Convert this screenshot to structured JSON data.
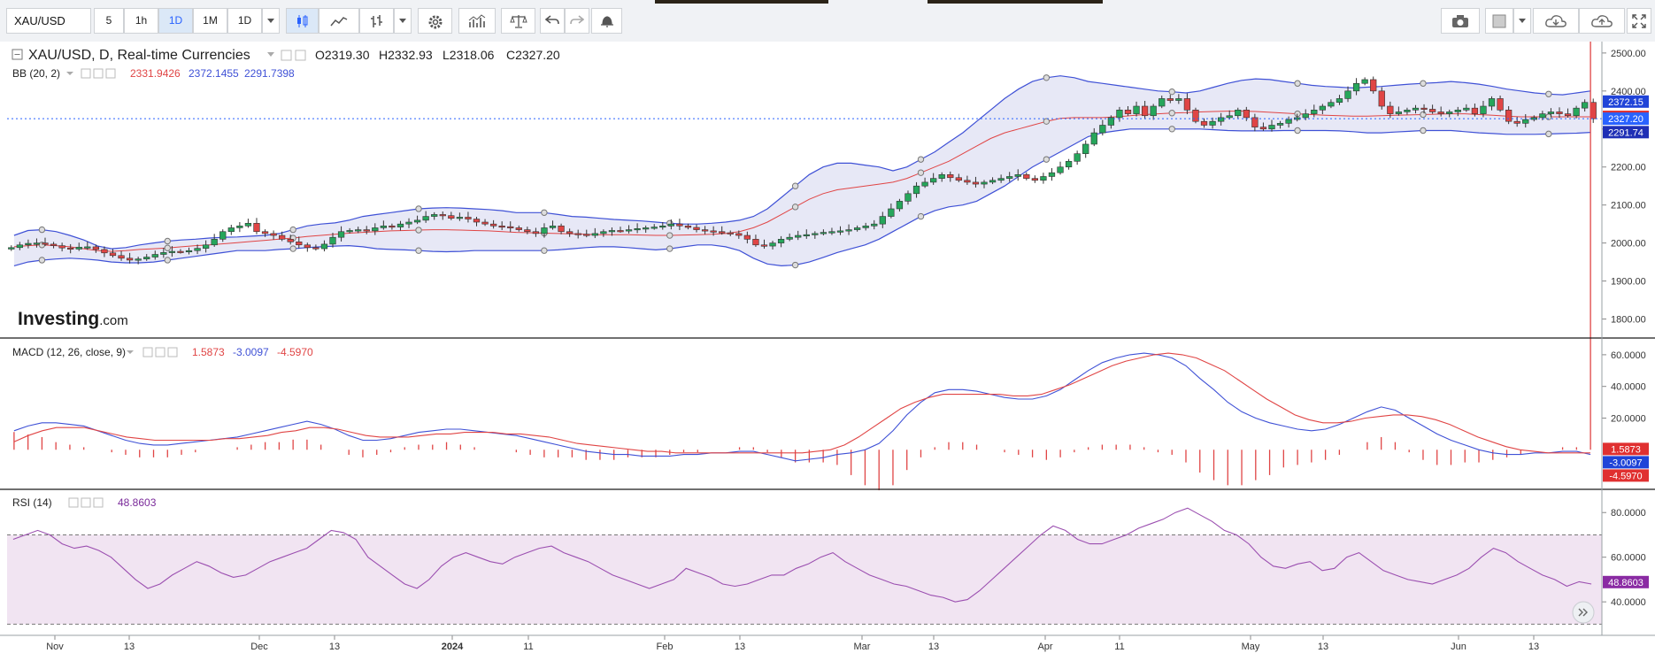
{
  "toolbar": {
    "symbol": "XAU/USD",
    "intervals": [
      "5",
      "1h",
      "1D",
      "1M",
      "1D"
    ],
    "active_interval_index": 2
  },
  "legend": {
    "title": "XAU/USD, D, Real-time Currencies",
    "open": "O2319.30",
    "high": "H2332.93",
    "low": "L2318.06",
    "close": "C2327.20",
    "bb_label": "BB (20, 2)",
    "bb_values": [
      "2331.9426",
      "2372.1455",
      "2291.7398"
    ],
    "macd_label": "MACD (12, 26, close, 9)",
    "macd_values": [
      "1.5873",
      "-3.0097",
      "-4.5970"
    ],
    "rsi_label": "RSI (14)",
    "rsi_value": "48.8603"
  },
  "watermark": {
    "brand": "Investing",
    "suffix": ".com"
  },
  "colors": {
    "up": "#26a65b",
    "down": "#e04545",
    "bb_band": "#3f51d6",
    "bb_mid": "#e04545",
    "bb_fill": "#e3e4f4",
    "macd_line": "#3f51d6",
    "signal_line": "#e04545",
    "rsi_line": "#9b4fb0",
    "rsi_fill": "#f1e4f2"
  },
  "chart_data": [
    {
      "type": "candlestick",
      "title": "XAU/USD, D, Real-time Currencies",
      "ylim": [
        1750,
        2530
      ],
      "y_ticks": [
        "2500.00",
        "2400.00",
        "2300.00",
        "2200.00",
        "2100.00",
        "2000.00",
        "1900.00",
        "1800.00"
      ],
      "x_ticks": [
        "Nov",
        "13",
        "Dec",
        "13",
        "2024",
        "11",
        "Feb",
        "13",
        "Mar",
        "13",
        "Apr",
        "11",
        "May",
        "13",
        "Jun",
        "13"
      ],
      "close_series": [
        1988,
        1995,
        1999,
        2000,
        1997,
        1993,
        1987,
        1984,
        1989,
        1990,
        1983,
        1974,
        1967,
        1960,
        1955,
        1958,
        1963,
        1970,
        1975,
        1978,
        1977,
        1980,
        1986,
        1995,
        2010,
        2030,
        2040,
        2045,
        2052,
        2030,
        2025,
        2020,
        2010,
        2003,
        1995,
        1988,
        1985,
        1997,
        2015,
        2030,
        2033,
        2035,
        2032,
        2040,
        2045,
        2042,
        2050,
        2055,
        2060,
        2070,
        2075,
        2072,
        2065,
        2068,
        2063,
        2055,
        2050,
        2045,
        2043,
        2040,
        2035,
        2030,
        2025,
        2040,
        2045,
        2030,
        2025,
        2023,
        2020,
        2025,
        2030,
        2033,
        2032,
        2035,
        2038,
        2040,
        2042,
        2045,
        2050,
        2045,
        2041,
        2035,
        2032,
        2030,
        2027,
        2025,
        2020,
        2010,
        1995,
        1992,
        2000,
        2010,
        2015,
        2020,
        2022,
        2025,
        2028,
        2030,
        2032,
        2035,
        2040,
        2045,
        2050,
        2070,
        2090,
        2110,
        2130,
        2150,
        2160,
        2170,
        2180,
        2172,
        2165,
        2160,
        2155,
        2160,
        2165,
        2170,
        2175,
        2180,
        2170,
        2165,
        2175,
        2185,
        2200,
        2215,
        2235,
        2260,
        2290,
        2310,
        2330,
        2350,
        2340,
        2360,
        2335,
        2360,
        2380,
        2375,
        2380,
        2350,
        2320,
        2310,
        2320,
        2330,
        2335,
        2350,
        2330,
        2305,
        2300,
        2310,
        2315,
        2325,
        2330,
        2340,
        2350,
        2360,
        2370,
        2380,
        2400,
        2420,
        2430,
        2400,
        2360,
        2340,
        2345,
        2350,
        2355,
        2352,
        2345,
        2340,
        2345,
        2350,
        2355,
        2340,
        2360,
        2380,
        2350,
        2320,
        2315,
        2325,
        2330,
        2340,
        2345,
        2340,
        2335,
        2355,
        2370,
        2327
      ],
      "bb_upper_series": [
        2020,
        2033,
        2035,
        2030,
        2020,
        2008,
        1992,
        1985,
        1988,
        1995,
        2000,
        2005,
        2008,
        2010,
        2013,
        2015,
        2016,
        2018,
        2020,
        2025,
        2035,
        2045,
        2050,
        2053,
        2060,
        2070,
        2075,
        2080,
        2085,
        2090,
        2092,
        2093,
        2092,
        2090,
        2088,
        2085,
        2080,
        2080,
        2080,
        2075,
        2070,
        2068,
        2065,
        2062,
        2060,
        2058,
        2055,
        2052,
        2050,
        2050,
        2052,
        2055,
        2060,
        2070,
        2090,
        2120,
        2150,
        2180,
        2200,
        2210,
        2210,
        2205,
        2200,
        2190,
        2200,
        2220,
        2240,
        2265,
        2290,
        2320,
        2350,
        2380,
        2405,
        2425,
        2435,
        2440,
        2435,
        2425,
        2420,
        2415,
        2410,
        2405,
        2400,
        2398,
        2395,
        2400,
        2410,
        2420,
        2428,
        2432,
        2430,
        2425,
        2420,
        2415,
        2412,
        2410,
        2408,
        2410,
        2412,
        2415,
        2418,
        2420,
        2422,
        2425,
        2422,
        2418,
        2412,
        2405,
        2400,
        2395,
        2392,
        2390,
        2395,
        2400
      ],
      "bb_mid_series": [
        1990,
        1993,
        1995,
        1993,
        1990,
        1985,
        1980,
        1978,
        1980,
        1983,
        1985,
        1987,
        1990,
        1993,
        1995,
        1998,
        2001,
        2004,
        2007,
        2010,
        2013,
        2017,
        2020,
        2023,
        2026,
        2028,
        2030,
        2032,
        2033,
        2034,
        2035,
        2035,
        2034,
        2033,
        2032,
        2030,
        2028,
        2027,
        2026,
        2025,
        2024,
        2023,
        2022,
        2022,
        2022,
        2021,
        2020,
        2020,
        2021,
        2022,
        2023,
        2025,
        2030,
        2040,
        2055,
        2075,
        2095,
        2115,
        2130,
        2140,
        2145,
        2150,
        2155,
        2160,
        2170,
        2185,
        2200,
        2215,
        2235,
        2255,
        2275,
        2290,
        2300,
        2310,
        2320,
        2328,
        2330,
        2330,
        2330,
        2332,
        2335,
        2338,
        2340,
        2342,
        2343,
        2345,
        2346,
        2347,
        2347,
        2346,
        2344,
        2342,
        2340,
        2338,
        2336,
        2335,
        2334,
        2334,
        2335,
        2336,
        2337,
        2338,
        2339,
        2340,
        2340,
        2338,
        2336,
        2334,
        2332,
        2332,
        2332,
        2332,
        2332,
        2332
      ],
      "bb_lower_series": [
        1940,
        1950,
        1955,
        1958,
        1960,
        1958,
        1955,
        1950,
        1948,
        1948,
        1950,
        1955,
        1960,
        1965,
        1970,
        1975,
        1980,
        1980,
        1980,
        1983,
        1985,
        1988,
        1990,
        1992,
        1993,
        1990,
        1985,
        1983,
        1982,
        1980,
        1978,
        1977,
        1978,
        1980,
        1980,
        1980,
        1980,
        1980,
        1980,
        1982,
        1985,
        1988,
        1990,
        1990,
        1988,
        1985,
        1982,
        1985,
        1990,
        1995,
        1995,
        1990,
        1980,
        1960,
        1945,
        1940,
        1942,
        1950,
        1962,
        1975,
        1985,
        1995,
        2010,
        2030,
        2050,
        2070,
        2085,
        2095,
        2100,
        2110,
        2130,
        2150,
        2175,
        2200,
        2220,
        2240,
        2260,
        2280,
        2290,
        2295,
        2300,
        2300,
        2300,
        2300,
        2300,
        2300,
        2298,
        2296,
        2295,
        2295,
        2295,
        2296,
        2296,
        2296,
        2296,
        2295,
        2293,
        2290,
        2290,
        2292,
        2294,
        2296,
        2296,
        2296,
        2293,
        2290,
        2288,
        2286,
        2286,
        2286,
        2287,
        2288,
        2289,
        2291
      ]
    },
    {
      "type": "line",
      "title": "MACD (12, 26, close, 9)",
      "ylim": [
        -25,
        70
      ],
      "y_ticks": [
        "60.0000",
        "40.0000",
        "20.0000"
      ],
      "series": [
        {
          "name": "MACD",
          "values": [
            12,
            15,
            17,
            17,
            16,
            15,
            12,
            9,
            6,
            4,
            3,
            3,
            4,
            5,
            6,
            7,
            8,
            10,
            12,
            14,
            16,
            18,
            16,
            13,
            9,
            6,
            6,
            7,
            9,
            11,
            12,
            13,
            13,
            12,
            11,
            10,
            9,
            7,
            5,
            3,
            1,
            -1,
            -2,
            -3,
            -3,
            -4,
            -4,
            -4,
            -3,
            -3,
            -2,
            -2,
            -1,
            -1,
            -3,
            -5,
            -7,
            -6,
            -5,
            -3,
            -2,
            0,
            4,
            12,
            22,
            30,
            36,
            38,
            38,
            37,
            35,
            33,
            32,
            32,
            34,
            38,
            44,
            50,
            55,
            58,
            60,
            61,
            60,
            58,
            53,
            45,
            38,
            30,
            24,
            20,
            17,
            15,
            13,
            12,
            13,
            16,
            20,
            24,
            27,
            25,
            20,
            15,
            10,
            6,
            3,
            0,
            -2,
            -3,
            -3,
            -2,
            -2,
            -1,
            -1,
            -3
          ]
        },
        {
          "name": "Signal",
          "values": [
            5,
            9,
            12,
            14,
            14,
            14,
            12,
            10,
            8,
            7,
            6,
            6,
            6,
            6,
            6,
            7,
            7,
            8,
            9,
            11,
            12,
            14,
            14,
            13,
            11,
            9,
            8,
            8,
            8,
            9,
            10,
            10,
            11,
            11,
            11,
            10,
            10,
            9,
            8,
            6,
            4,
            3,
            2,
            1,
            0,
            -1,
            -1,
            -2,
            -2,
            -2,
            -2,
            -2,
            -2,
            -2,
            -2,
            -2,
            -2,
            -1,
            0,
            3,
            8,
            14,
            20,
            26,
            30,
            33,
            35,
            35,
            35,
            35,
            35,
            34,
            34,
            35,
            38,
            41,
            45,
            49,
            53,
            56,
            58,
            60,
            61,
            60,
            58,
            54,
            50,
            44,
            38,
            32,
            27,
            22,
            19,
            17,
            17,
            18,
            20,
            21,
            22,
            22,
            21,
            19,
            16,
            12,
            8,
            5,
            2,
            0,
            -1,
            -2,
            -2,
            -2,
            -2
          ]
        }
      ]
    },
    {
      "type": "line",
      "title": "RSI (14)",
      "ylim": [
        25,
        90
      ],
      "y_ticks": [
        "80.0000",
        "60.0000",
        "40.0000"
      ],
      "series": [
        {
          "name": "RSI (14)",
          "values": [
            68,
            70,
            72,
            70,
            66,
            64,
            65,
            63,
            60,
            55,
            50,
            46,
            48,
            52,
            55,
            58,
            56,
            53,
            51,
            52,
            55,
            58,
            60,
            62,
            64,
            68,
            72,
            71,
            68,
            60,
            56,
            52,
            48,
            46,
            50,
            56,
            60,
            62,
            60,
            58,
            57,
            60,
            62,
            64,
            65,
            62,
            60,
            58,
            55,
            52,
            50,
            48,
            46,
            48,
            50,
            55,
            53,
            51,
            48,
            47,
            48,
            50,
            52,
            52,
            55,
            57,
            60,
            62,
            58,
            55,
            52,
            50,
            48,
            47,
            45,
            43,
            42,
            40,
            41,
            45,
            50,
            55,
            60,
            65,
            70,
            74,
            72,
            68,
            66,
            66,
            68,
            70,
            73,
            75,
            77,
            80,
            82,
            79,
            76,
            72,
            70,
            66,
            60,
            56,
            55,
            57,
            58,
            54,
            55,
            60,
            62,
            58,
            54,
            52,
            50,
            49,
            48,
            50,
            52,
            55,
            60,
            64,
            62,
            58,
            55,
            52,
            50,
            47,
            49,
            48
          ]
        }
      ]
    }
  ]
}
